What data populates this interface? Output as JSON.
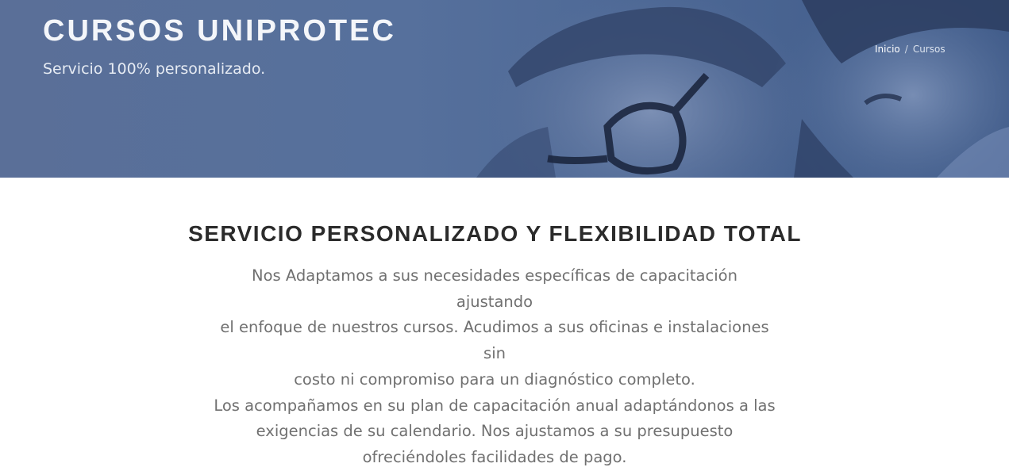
{
  "hero": {
    "title": "CURSOS UNIPROTEC",
    "subtitle": "Servicio 100% personalizado.",
    "breadcrumb": {
      "home": "Inicio",
      "separator": "/",
      "current": "Cursos"
    }
  },
  "section": {
    "title": "SERVICIO PERSONALIZADO Y FLEXIBILIDAD TOTAL",
    "lines": [
      "Nos Adaptamos a sus necesidades específicas de capacitación ajustando",
      "el enfoque de nuestros cursos. Acudimos a sus oficinas e instalaciones sin",
      "costo ni compromiso para un diagnóstico completo.",
      "Los acompañamos en su plan de capacitación anual adaptándonos a las",
      "exigencias de su calendario. Nos ajustamos a su presupuesto",
      "ofreciéndoles facilidades de pago."
    ]
  },
  "colors": {
    "hero_overlay": "#56709c",
    "title_text": "#2b2b2b",
    "body_text": "#707070"
  }
}
